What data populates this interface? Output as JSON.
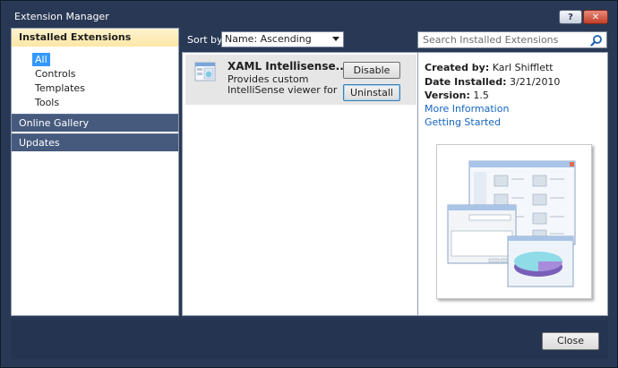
{
  "window": {
    "title": "Extension Manager",
    "help_label": "?",
    "close_label": "✕"
  },
  "sidebar": {
    "installed_label": "Installed Extensions",
    "items": [
      {
        "label": "All",
        "selected": true
      },
      {
        "label": "Controls"
      },
      {
        "label": "Templates"
      },
      {
        "label": "Tools"
      }
    ],
    "online_label": "Online Gallery",
    "updates_label": "Updates"
  },
  "toolbar": {
    "sort_label": "Sort by:",
    "sort_value": "Name: Ascending",
    "search_placeholder": "Search Installed Extensions"
  },
  "extensions": [
    {
      "title": "XAML Intellisense...",
      "desc_line1": "Provides custom",
      "desc_line2": "IntelliSense viewer for th...",
      "disable_label": "Disable",
      "uninstall_label": "Uninstall"
    }
  ],
  "details": {
    "created_by_label": "Created by:",
    "created_by_value": "Karl Shifflett",
    "date_label": "Date Installed:",
    "date_value": "3/21/2010",
    "version_label": "Version:",
    "version_value": "1.5",
    "more_info_link": "More Information",
    "getting_started_link": "Getting Started"
  },
  "footer": {
    "close_label": "Close"
  },
  "colors": {
    "accent": "#3399ff",
    "frame": "#293955",
    "link": "#1565c0"
  }
}
